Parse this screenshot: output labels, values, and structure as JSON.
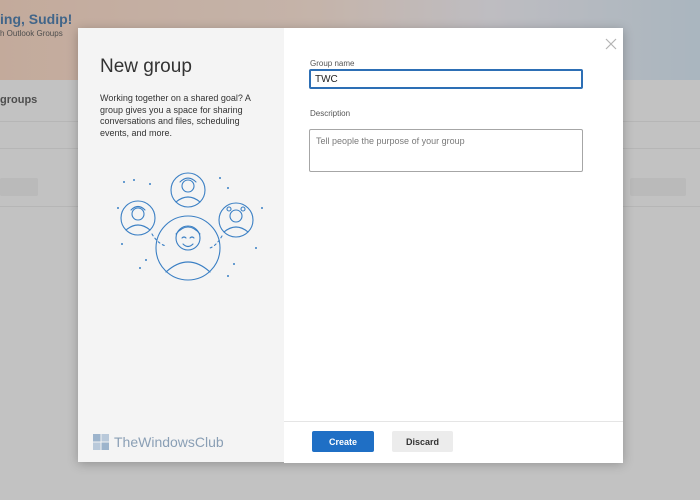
{
  "background": {
    "greeting": "ing, Sudip!",
    "subtitle": "h Outlook Groups",
    "section_title": "groups"
  },
  "dialog": {
    "title": "New group",
    "description": "Working together on a shared goal? A group gives you a space for sharing conversations and files, scheduling events, and more.",
    "group_name_label": "Group name",
    "group_name_value": "TWC",
    "description_label": "Description",
    "description_placeholder": "Tell people the purpose of your group",
    "create_label": "Create",
    "discard_label": "Discard",
    "close_icon": "close-icon",
    "illustration_icon": "group-people-icon"
  },
  "watermark": {
    "text": "TheWindowsClub"
  },
  "colors": {
    "accent": "#1f6fc5",
    "input_focus": "#2d6fb5",
    "illustration_stroke": "#3a7fc4"
  }
}
